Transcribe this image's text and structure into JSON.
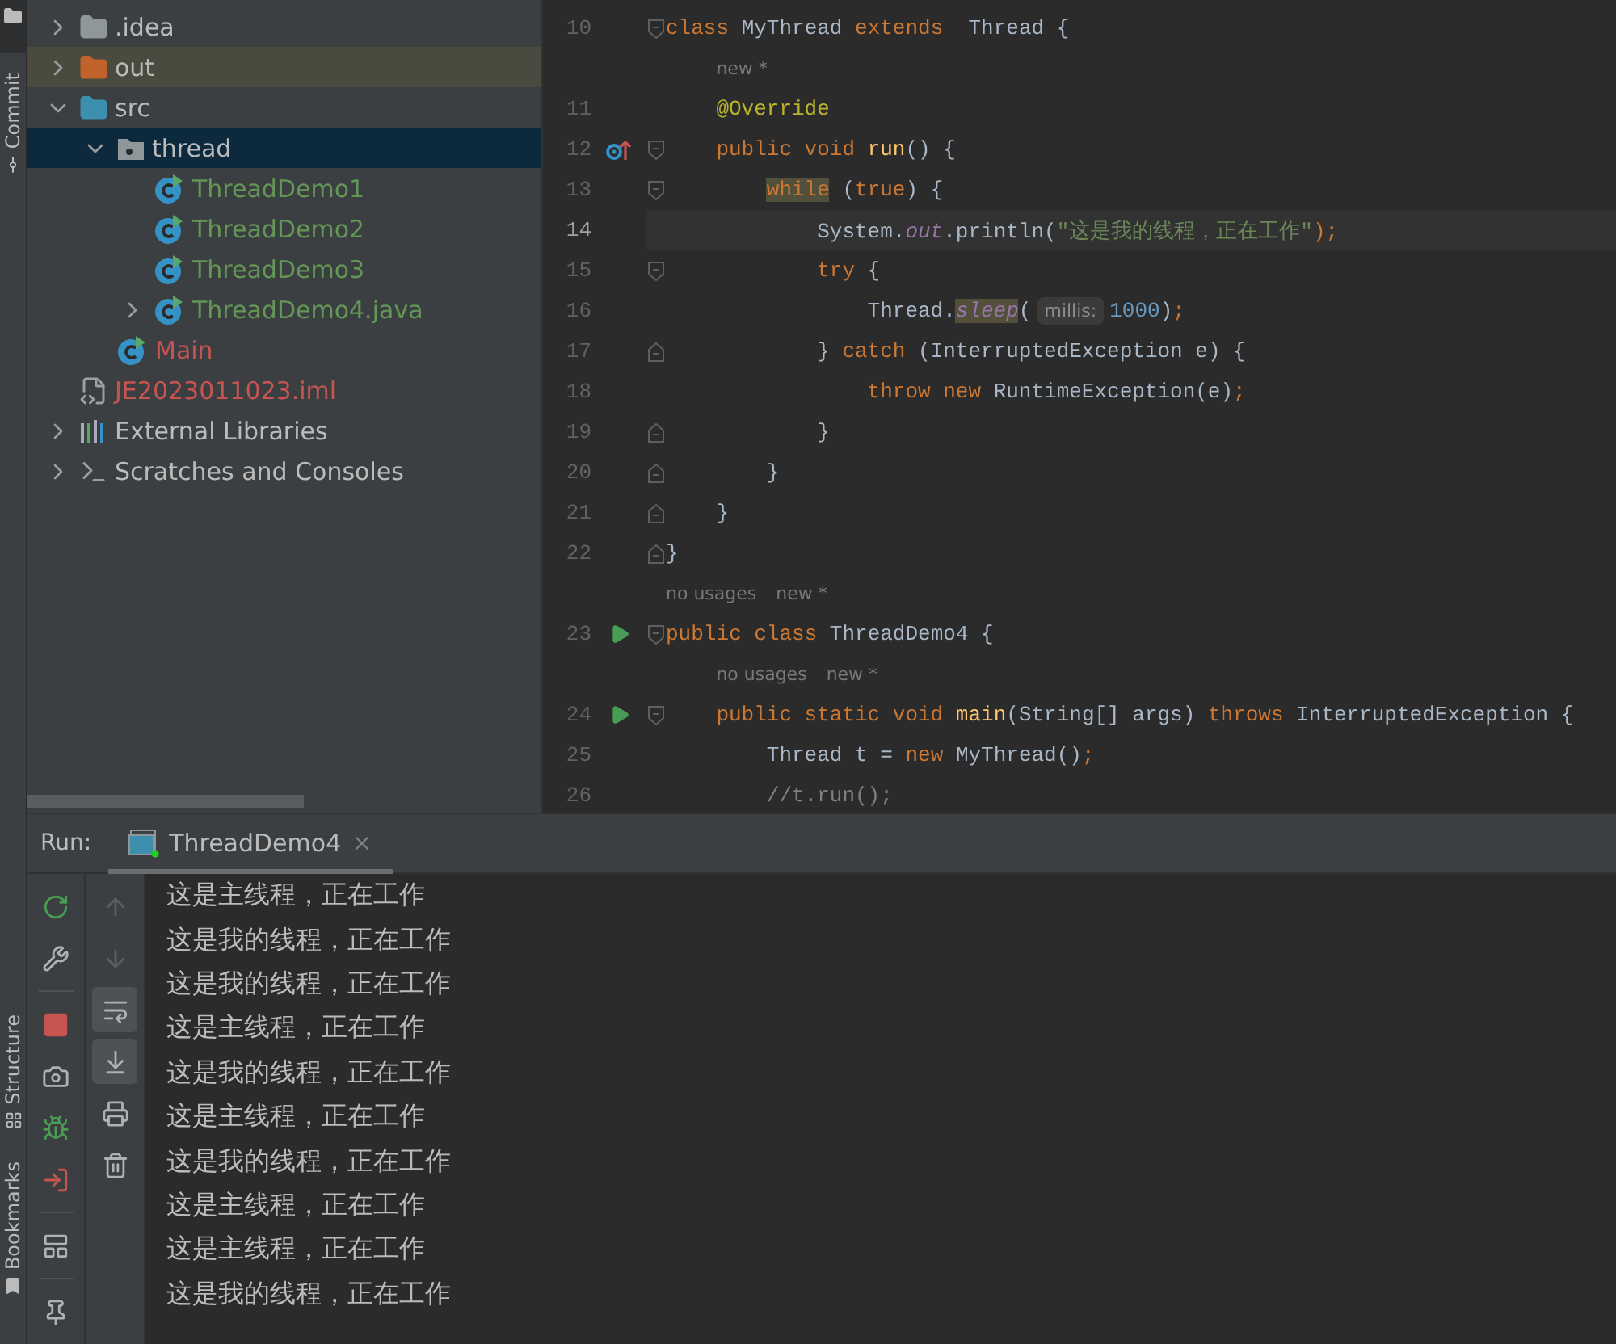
{
  "tool_strip": {
    "items": [
      {
        "label": "Commit",
        "kind": "commit"
      },
      {
        "label": "Structure",
        "kind": "structure"
      },
      {
        "label": "Bookmarks",
        "kind": "bookmarks"
      }
    ]
  },
  "project": {
    "tree": [
      {
        "label": ".idea",
        "kind": "folder",
        "expanded": false,
        "selected": false,
        "color": "#bbbbbb"
      },
      {
        "label": "out",
        "kind": "excluded-folder",
        "expanded": false,
        "selected": false,
        "color": "#bbbbbb"
      },
      {
        "label": "src",
        "kind": "source-folder",
        "expanded": true,
        "selected": false,
        "color": "#bbbbbb",
        "children": [
          {
            "label": "thread",
            "kind": "package",
            "expanded": true,
            "selected": true,
            "color": "#bbbbbb",
            "children": [
              {
                "label": "ThreadDemo1",
                "kind": "class",
                "selected": false,
                "color": "#629755"
              },
              {
                "label": "ThreadDemo2",
                "kind": "class",
                "selected": false,
                "color": "#629755"
              },
              {
                "label": "ThreadDemo3",
                "kind": "class",
                "selected": false,
                "color": "#629755"
              },
              {
                "label": "ThreadDemo4.java",
                "kind": "class",
                "expanded": false,
                "selected": false,
                "color": "#629755"
              }
            ]
          },
          {
            "label": "Main",
            "kind": "class",
            "selected": false,
            "color": "#c75450"
          }
        ]
      },
      {
        "label": "JE2023011023.iml",
        "kind": "file",
        "selected": false,
        "color": "#c75450"
      },
      {
        "label": "External Libraries",
        "kind": "libraries",
        "expanded": false,
        "selected": false,
        "color": "#bbbbbb"
      },
      {
        "label": "Scratches and Consoles",
        "kind": "scratches",
        "expanded": false,
        "selected": false,
        "color": "#bbbbbb"
      }
    ]
  },
  "editor": {
    "lines": [
      {
        "kind": "code",
        "number": "10",
        "fold_start": true,
        "fold_end": false,
        "run_marker": false,
        "override_marker": false,
        "selected": false,
        "tokens": [
          {
            "text": "class ",
            "kind": "keyword"
          },
          {
            "text": "MyThread ",
            "kind": "plain"
          },
          {
            "text": "extends  ",
            "kind": "keyword"
          },
          {
            "text": "Thread {",
            "kind": "plain"
          }
        ]
      },
      {
        "kind": "hint",
        "hints": [
          "new *"
        ]
      },
      {
        "kind": "code",
        "number": "11",
        "fold_start": false,
        "fold_end": false,
        "run_marker": false,
        "override_marker": false,
        "selected": false,
        "tokens": [
          {
            "text": "    @Override",
            "kind": "annotation"
          }
        ]
      },
      {
        "kind": "code",
        "number": "12",
        "fold_start": true,
        "fold_end": false,
        "run_marker": false,
        "override_marker": true,
        "selected": false,
        "tokens": [
          {
            "text": "    public void ",
            "kind": "keyword"
          },
          {
            "text": "run",
            "kind": "method"
          },
          {
            "text": "() {",
            "kind": "plain"
          }
        ]
      },
      {
        "kind": "code",
        "number": "13",
        "fold_start": true,
        "fold_end": false,
        "run_marker": false,
        "override_marker": false,
        "selected": false,
        "tokens": [
          {
            "text": "        while",
            "kind": "keyword-highlight"
          },
          {
            "text": " (",
            "kind": "plain"
          },
          {
            "text": "true",
            "kind": "keyword"
          },
          {
            "text": ") {",
            "kind": "plain"
          }
        ]
      },
      {
        "kind": "code",
        "number": "14",
        "fold_start": false,
        "fold_end": false,
        "run_marker": false,
        "override_marker": false,
        "selected": true,
        "tokens": [
          {
            "text": "            System.",
            "kind": "plain"
          },
          {
            "text": "out",
            "kind": "static"
          },
          {
            "text": ".println(",
            "kind": "plain"
          },
          {
            "text": "\"这是我的线程，正在工作\"",
            "kind": "string"
          },
          {
            "text": ");",
            "kind": "keyword"
          }
        ]
      },
      {
        "kind": "code",
        "number": "15",
        "fold_start": true,
        "fold_end": false,
        "run_marker": false,
        "override_marker": false,
        "selected": false,
        "tokens": [
          {
            "text": "            try",
            "kind": "keyword"
          },
          {
            "text": " {",
            "kind": "plain"
          }
        ]
      },
      {
        "kind": "code",
        "number": "16",
        "fold_start": false,
        "fold_end": false,
        "run_marker": false,
        "override_marker": false,
        "selected": false,
        "tokens": [
          {
            "text": "                Thread.",
            "kind": "plain"
          },
          {
            "text": "sleep",
            "kind": "static-highlight"
          },
          {
            "text": "(",
            "kind": "plain"
          },
          {
            "text": "millis:",
            "kind": "inlay"
          },
          {
            "text": "1000",
            "kind": "number"
          },
          {
            "text": ")",
            "kind": "plain"
          },
          {
            "text": ";",
            "kind": "keyword"
          }
        ]
      },
      {
        "kind": "code",
        "number": "17",
        "fold_start": false,
        "fold_end": true,
        "run_marker": false,
        "override_marker": false,
        "selected": false,
        "tokens": [
          {
            "text": "            } ",
            "kind": "plain"
          },
          {
            "text": "catch",
            "kind": "keyword"
          },
          {
            "text": " (InterruptedException e) {",
            "kind": "plain"
          }
        ]
      },
      {
        "kind": "code",
        "number": "18",
        "fold_start": false,
        "fold_end": false,
        "run_marker": false,
        "override_marker": false,
        "selected": false,
        "tokens": [
          {
            "text": "                throw new ",
            "kind": "keyword"
          },
          {
            "text": "RuntimeException(e)",
            "kind": "plain"
          },
          {
            "text": ";",
            "kind": "keyword"
          }
        ]
      },
      {
        "kind": "code",
        "number": "19",
        "fold_start": false,
        "fold_end": true,
        "run_marker": false,
        "override_marker": false,
        "selected": false,
        "tokens": [
          {
            "text": "            }",
            "kind": "plain"
          }
        ]
      },
      {
        "kind": "code",
        "number": "20",
        "fold_start": false,
        "fold_end": true,
        "run_marker": false,
        "override_marker": false,
        "selected": false,
        "tokens": [
          {
            "text": "        }",
            "kind": "plain"
          }
        ]
      },
      {
        "kind": "code",
        "number": "21",
        "fold_start": false,
        "fold_end": true,
        "run_marker": false,
        "override_marker": false,
        "selected": false,
        "tokens": [
          {
            "text": "    }",
            "kind": "plain"
          }
        ]
      },
      {
        "kind": "code",
        "number": "22",
        "fold_start": false,
        "fold_end": true,
        "run_marker": false,
        "override_marker": false,
        "selected": false,
        "tokens": [
          {
            "text": "}",
            "kind": "plain"
          }
        ]
      },
      {
        "kind": "hint",
        "hints": [
          "no usages",
          "new *"
        ]
      },
      {
        "kind": "code",
        "number": "23",
        "fold_start": true,
        "fold_end": false,
        "run_marker": true,
        "override_marker": false,
        "selected": false,
        "tokens": [
          {
            "text": "public class ",
            "kind": "keyword"
          },
          {
            "text": "ThreadDemo4 {",
            "kind": "plain"
          }
        ]
      },
      {
        "kind": "hint",
        "hints": [
          "no usages",
          "new *"
        ]
      },
      {
        "kind": "code",
        "number": "24",
        "fold_start": true,
        "fold_end": false,
        "run_marker": true,
        "override_marker": false,
        "selected": false,
        "tokens": [
          {
            "text": "    public static void ",
            "kind": "keyword"
          },
          {
            "text": "main",
            "kind": "method"
          },
          {
            "text": "(String[] args) ",
            "kind": "plain"
          },
          {
            "text": "throws ",
            "kind": "keyword"
          },
          {
            "text": "InterruptedException {",
            "kind": "plain"
          }
        ]
      },
      {
        "kind": "code",
        "number": "25",
        "fold_start": false,
        "fold_end": false,
        "run_marker": false,
        "override_marker": false,
        "selected": false,
        "tokens": [
          {
            "text": "        Thread t = ",
            "kind": "plain"
          },
          {
            "text": "new ",
            "kind": "keyword"
          },
          {
            "text": "MyThread()",
            "kind": "plain"
          },
          {
            "text": ";",
            "kind": "keyword"
          }
        ]
      },
      {
        "kind": "code",
        "number": "26",
        "fold_start": false,
        "fold_end": false,
        "run_marker": false,
        "override_marker": false,
        "selected": false,
        "tokens": [
          {
            "text": "        //t.run();",
            "kind": "comment"
          }
        ]
      }
    ]
  },
  "run_panel": {
    "title": "Run:",
    "tabs": [
      {
        "label": "ThreadDemo4",
        "selected": true
      }
    ],
    "toolbar_left": [
      {
        "kind": "rerun"
      },
      {
        "kind": "settings"
      },
      {
        "kind": "separator"
      },
      {
        "kind": "stop"
      },
      {
        "kind": "camera"
      },
      {
        "kind": "debug"
      },
      {
        "kind": "exit"
      },
      {
        "kind": "separator"
      },
      {
        "kind": "layout"
      },
      {
        "kind": "separator"
      },
      {
        "kind": "pin"
      }
    ],
    "toolbar_right": [
      {
        "kind": "up",
        "disabled": true,
        "on": false
      },
      {
        "kind": "down",
        "disabled": true,
        "on": false
      },
      {
        "kind": "wrap",
        "disabled": false,
        "on": true
      },
      {
        "kind": "scroll-end",
        "disabled": false,
        "on": true
      },
      {
        "kind": "print",
        "disabled": false,
        "on": false
      },
      {
        "kind": "trash",
        "disabled": false,
        "on": false
      }
    ],
    "console": [
      "这是主线程，正在工作",
      "这是我的线程，正在工作",
      "这是我的线程，正在工作",
      "这是主线程，正在工作",
      "这是我的线程，正在工作",
      "这是主线程，正在工作",
      "这是我的线程，正在工作",
      "这是主线程，正在工作",
      "这是主线程，正在工作",
      "这是我的线程，正在工作"
    ]
  }
}
